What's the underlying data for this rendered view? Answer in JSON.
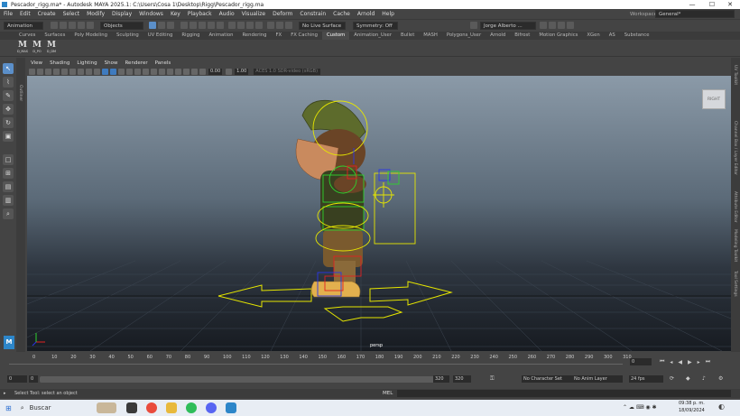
{
  "titlebar": {
    "title": "Pescador_rigg.ma* - Autodesk MAYA 2025.1: C:\\Users\\Cosa 1\\Desktop\\Rigg\\Pescador_rigg.ma",
    "min": "—",
    "max": "☐",
    "close": "✕"
  },
  "menubar": {
    "items": [
      "File",
      "Edit",
      "Create",
      "Select",
      "Modify",
      "Display",
      "Windows",
      "Key",
      "Playback",
      "Audio",
      "Visualize",
      "Deform",
      "Constrain",
      "Cache",
      "Arnold",
      "Help"
    ],
    "workspace_label": "Workspace:",
    "workspace_value": "General*"
  },
  "statusline": {
    "menuset": "Animation",
    "objects_label": "Objects",
    "live_surface": "No Live Surface",
    "symmetry": "Symmetry: Off",
    "user": "Jorge Alberto ..."
  },
  "shelf": {
    "tabs": [
      "Curves",
      "Surfaces",
      "Poly Modeling",
      "Sculpting",
      "UV Editing",
      "Rigging",
      "Animation",
      "Rendering",
      "FX",
      "FX Caching",
      "Custom",
      "Animation_User",
      "Bullet",
      "MASH",
      "Polygons_User",
      "Arnold",
      "Bifrost",
      "Motion Graphics",
      "XGen",
      "AS",
      "Substance"
    ],
    "active_tab": "Custom",
    "buttons": [
      {
        "glyph": "M",
        "label": "D_MAS"
      },
      {
        "glyph": "M",
        "label": "D_PO"
      },
      {
        "glyph": "M",
        "label": "D_DM"
      }
    ]
  },
  "panel": {
    "menus": [
      "View",
      "Shading",
      "Lighting",
      "Show",
      "Renderer",
      "Panels"
    ],
    "value_a": "0.00",
    "value_b": "1.00",
    "colorspace": "ACES 1.0 SDR-video (sRGB)",
    "camera": "persp",
    "viewcube": "RIGHT"
  },
  "side_tabs": {
    "left": "Outliner",
    "right": [
      "Channel Box / Layer Editor",
      "Attribute Editor",
      "Modeling Toolkit",
      "Tool Settings",
      "UV Toolkit"
    ]
  },
  "timeslider": {
    "ticks": [
      "0",
      "10",
      "20",
      "30",
      "40",
      "50",
      "60",
      "70",
      "80",
      "90",
      "100",
      "110",
      "120",
      "130",
      "140",
      "150",
      "160",
      "170",
      "180",
      "190",
      "200",
      "210",
      "220",
      "230",
      "240",
      "250",
      "260",
      "270",
      "280",
      "290",
      "300",
      "310"
    ],
    "current_frame": "0"
  },
  "rangebar": {
    "start": "0",
    "inner_start": "0",
    "inner_end": "320",
    "end": "320",
    "character_set": "No Character Set",
    "anim_layer": "No Anim Layer",
    "fps": "24 fps"
  },
  "commandline": {
    "mel_label": "MEL",
    "help": "Select Tool: select an object"
  },
  "taskbar": {
    "search": "Buscar",
    "time": "09:38 p. m.",
    "date": "18/09/2024"
  },
  "colors": {
    "maya_blue": "#5b8fc9",
    "rig_yellow": "#e6e600",
    "rig_green": "#2fd12f",
    "rig_red": "#e22222",
    "rig_blue": "#2a37e6"
  }
}
